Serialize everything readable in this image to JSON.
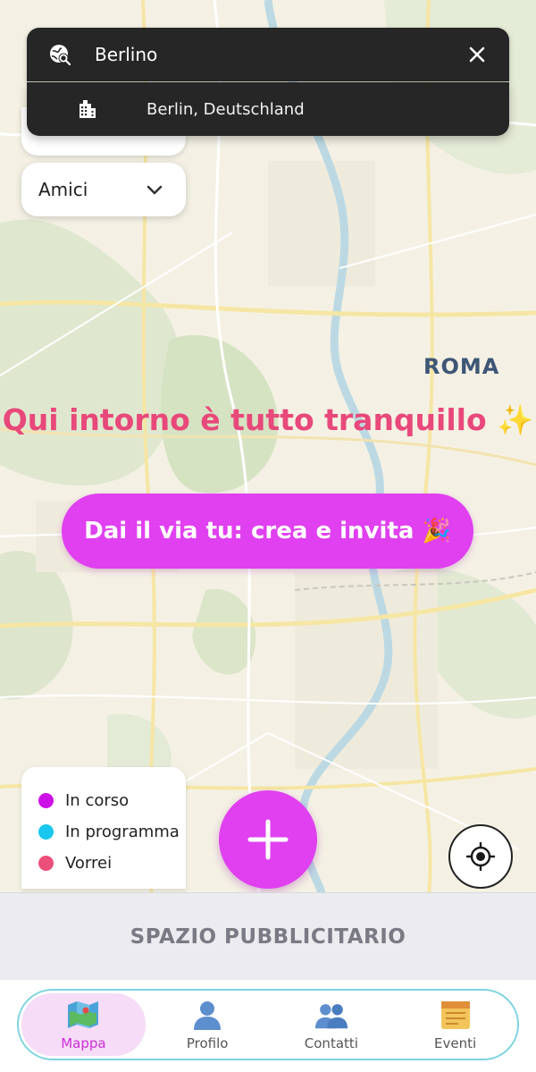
{
  "search": {
    "query": "Berlino",
    "suggestion": "Berlin, Deutschland"
  },
  "filter": {
    "selected": "Amici"
  },
  "map": {
    "city_label": "ROMA"
  },
  "empty_state": {
    "message": "Qui intorno è tutto tranquillo ✨",
    "cta_label": "Dai il via tu: crea e invita 🎉"
  },
  "legend": {
    "items": [
      {
        "label": "In corso",
        "color": "#cc10e6"
      },
      {
        "label": "In programma",
        "color": "#18c6ef"
      },
      {
        "label": "Vorrei",
        "color": "#ec4f79"
      }
    ]
  },
  "ad": {
    "label": "SPAZIO PUBBLICITARIO"
  },
  "nav": {
    "items": [
      {
        "label": "Mappa",
        "icon": "map-icon",
        "active": true
      },
      {
        "label": "Profilo",
        "icon": "user-icon",
        "active": false
      },
      {
        "label": "Contatti",
        "icon": "contacts-icon",
        "active": false
      },
      {
        "label": "Eventi",
        "icon": "calendar-icon",
        "active": false
      }
    ]
  },
  "colors": {
    "accent": "#e040f0",
    "message": "#e8487a",
    "search_bg": "#262626",
    "nav_border": "#7fd3e0"
  }
}
